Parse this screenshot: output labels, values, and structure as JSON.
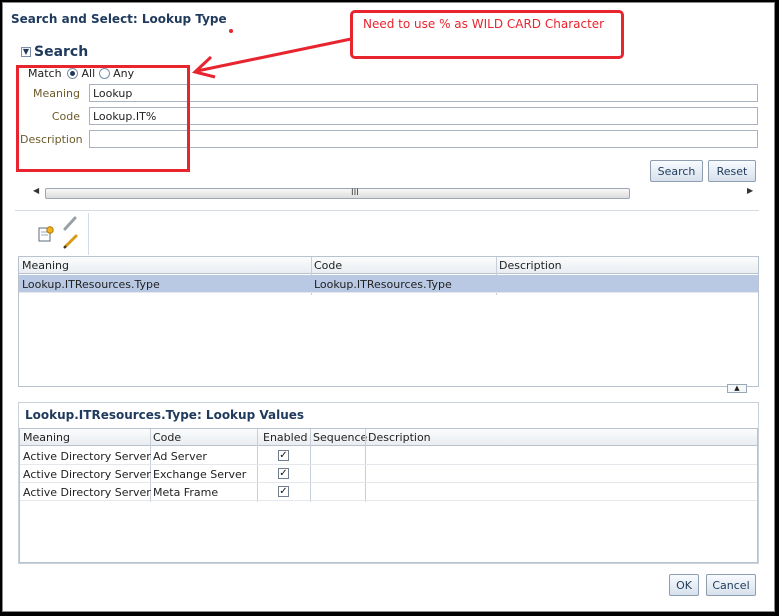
{
  "window": {
    "title": "Search and Select: Lookup Type"
  },
  "search": {
    "heading": "Search",
    "match_label": "Match",
    "match_options": [
      "All",
      "Any"
    ],
    "match_selected": "All",
    "fields": {
      "meaning": {
        "label": "Meaning",
        "value": "Lookup"
      },
      "code": {
        "label": "Code",
        "value": "Lookup.IT%"
      },
      "description": {
        "label": "Description",
        "value": ""
      }
    },
    "search_button": "Search",
    "reset_button": "Reset",
    "scroll_grip": "III"
  },
  "results": {
    "columns": [
      "Meaning",
      "Code",
      "Description"
    ],
    "rows": [
      {
        "meaning": "Lookup.ITResources.Type",
        "code": "Lookup.ITResources.Type",
        "description": ""
      }
    ]
  },
  "lookup_values": {
    "title": "Lookup.ITResources.Type: Lookup Values",
    "columns": [
      "Meaning",
      "Code",
      "Enabled",
      "Sequence",
      "Description"
    ],
    "rows": [
      {
        "meaning": "Active Directory Server",
        "code": "Ad Server",
        "enabled": true,
        "sequence": "",
        "description": ""
      },
      {
        "meaning": "Active Directory Server",
        "code": "Exchange Server",
        "enabled": true,
        "sequence": "",
        "description": ""
      },
      {
        "meaning": "Active Directory Server",
        "code": "Meta Frame",
        "enabled": true,
        "sequence": "",
        "description": ""
      }
    ]
  },
  "footer": {
    "ok": "OK",
    "cancel": "Cancel"
  },
  "annotation": {
    "text": "Need to use % as WILD CARD Character",
    "color": "#e8242f"
  },
  "icons": {
    "new": "new-record-icon",
    "edit": "pencil-edit-icon",
    "collapse": "collapse-arrow-icon"
  }
}
